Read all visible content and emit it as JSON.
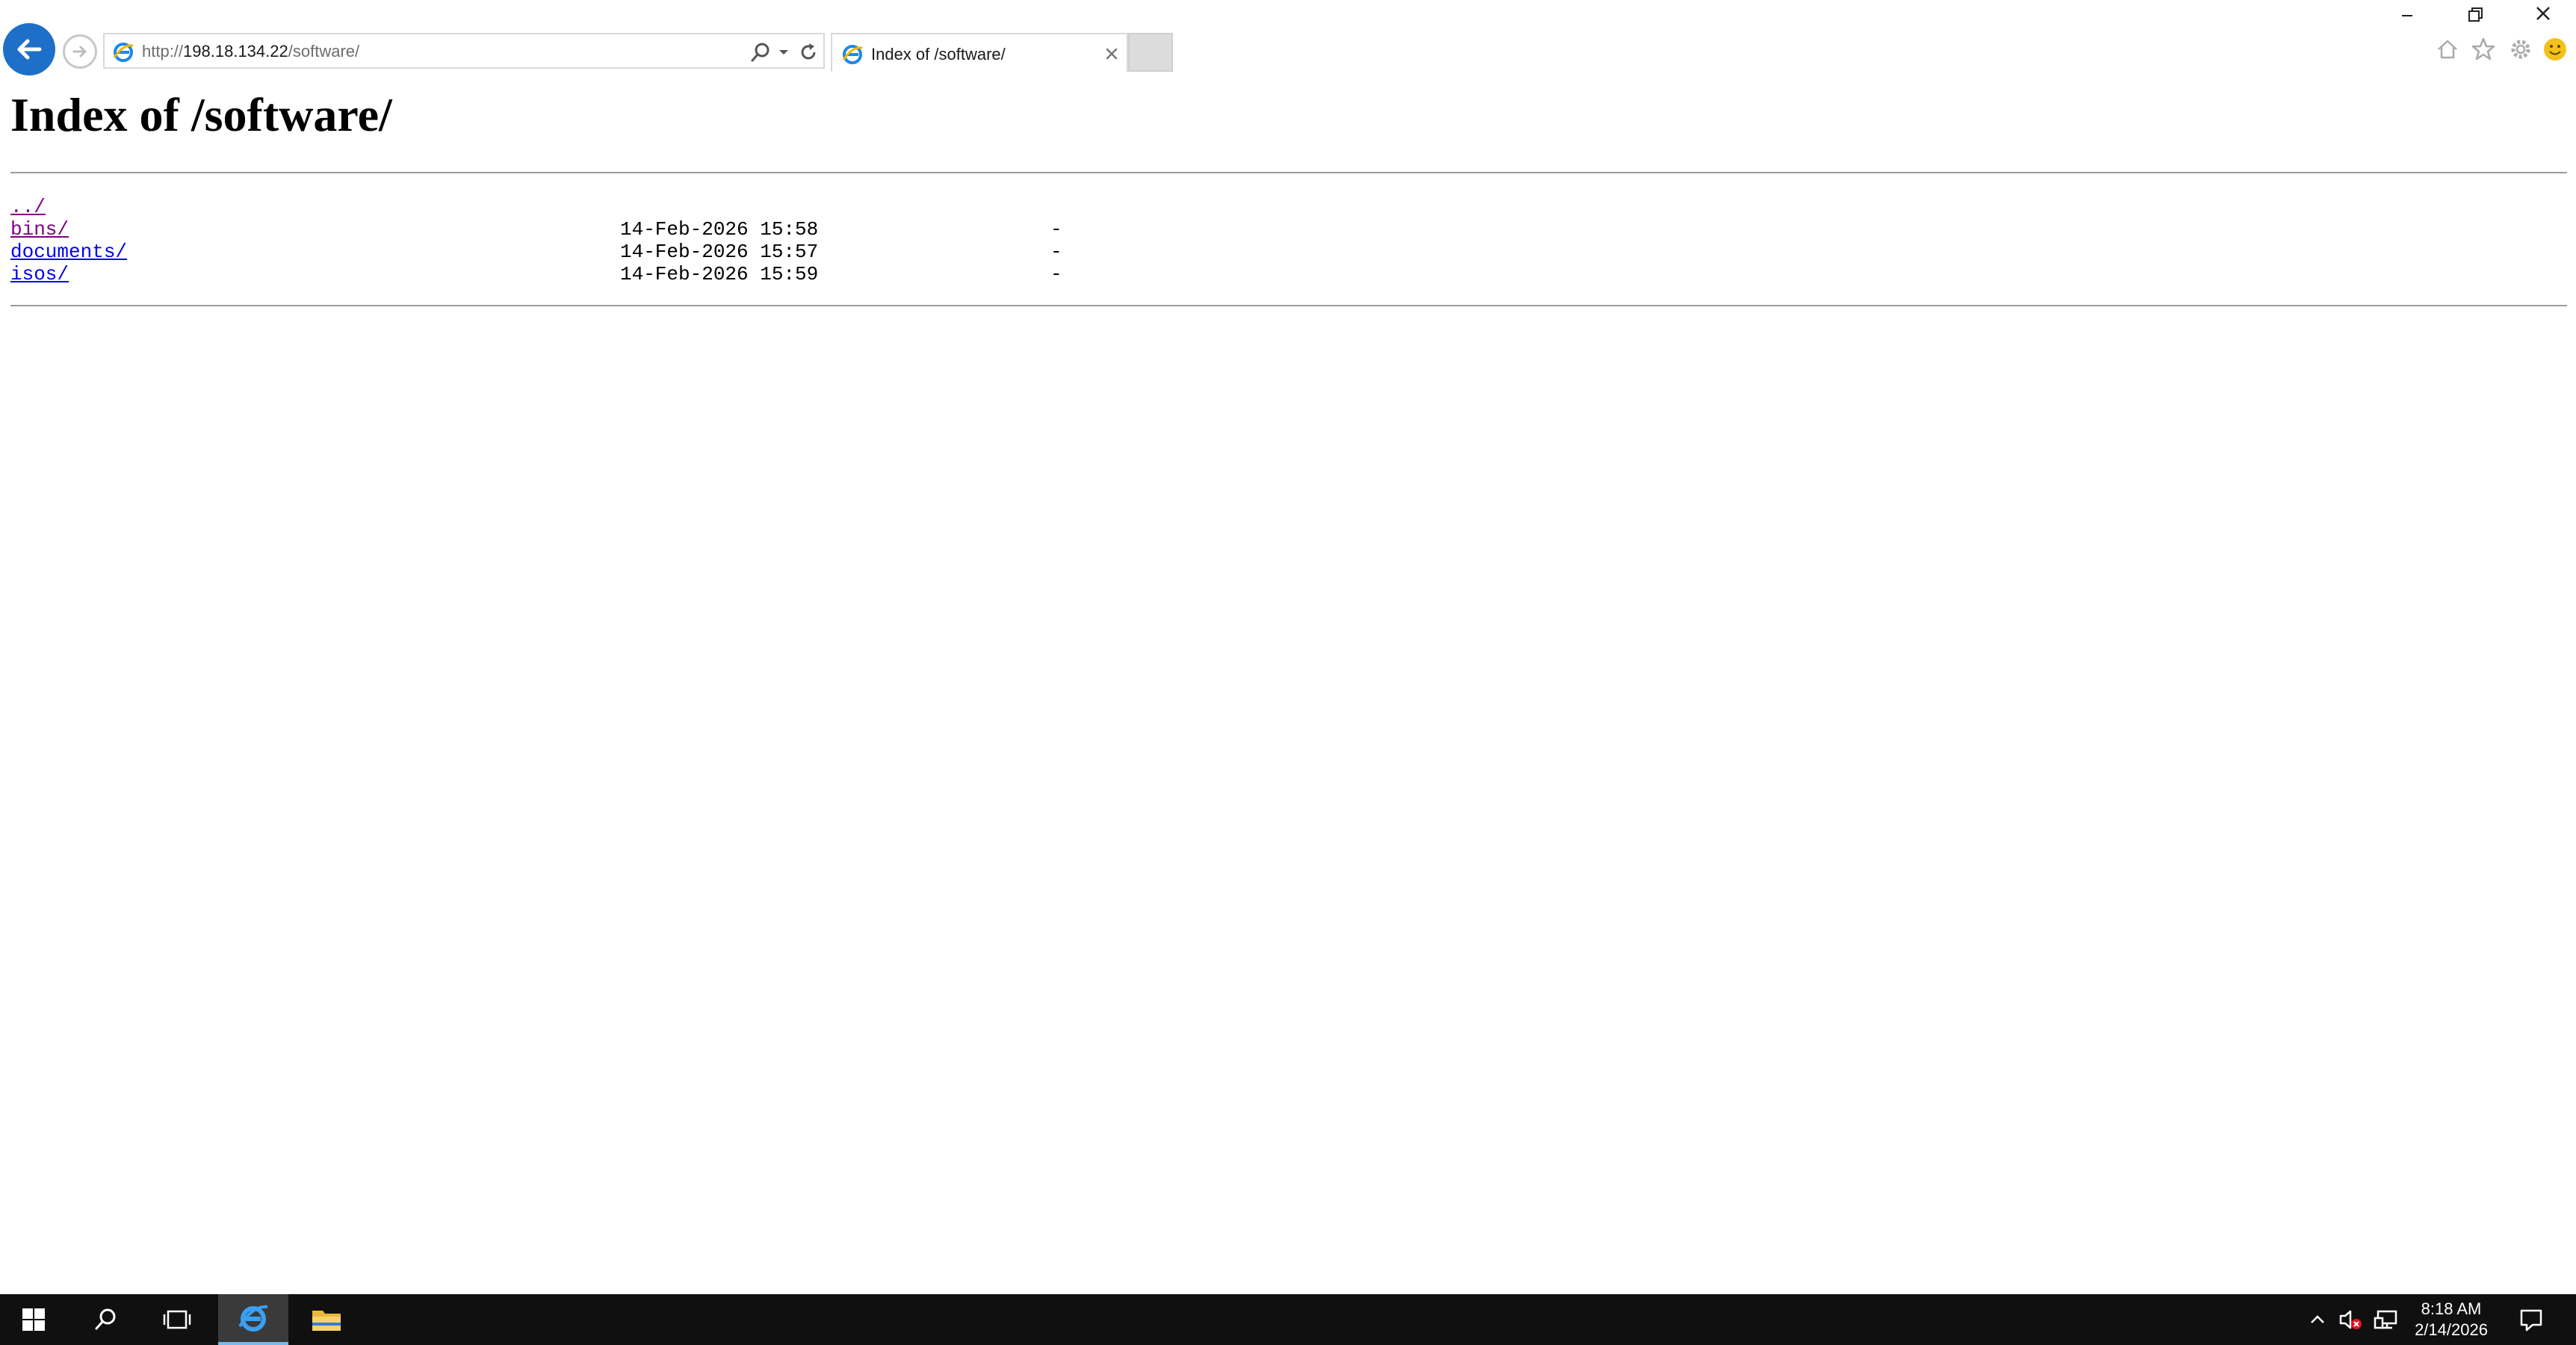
{
  "browser": {
    "address_scheme": "http://",
    "address_host": "198.18.134.22",
    "address_path": "/software/",
    "tab_title": "Index of /software/"
  },
  "page": {
    "title": "Index of /software/",
    "parent_link": "../",
    "entries": [
      {
        "name": "bins/",
        "date": "14-Feb-2026 15:58",
        "size": "-"
      },
      {
        "name": "documents/",
        "date": "14-Feb-2026 15:57",
        "size": "-"
      },
      {
        "name": "isos/",
        "date": "14-Feb-2026 15:59",
        "size": "-"
      }
    ]
  },
  "taskbar": {
    "time": "8:18 AM",
    "date": "2/14/2026"
  },
  "colors": {
    "link_visited": "#800080",
    "link_unvisited": "#0000ee",
    "ie_blue": "#1e6fc8",
    "taskbar_bg": "#101010"
  },
  "icons": [
    "back-arrow-icon",
    "forward-arrow-icon",
    "ie-icon",
    "search-icon",
    "dropdown-icon",
    "refresh-icon",
    "close-icon",
    "minimize-icon",
    "restore-icon",
    "home-icon",
    "star-icon",
    "gear-icon",
    "smiley-icon",
    "windows-start-icon",
    "taskview-icon",
    "folder-icon",
    "chevron-up-icon",
    "speaker-muted-icon",
    "network-icon",
    "notification-icon"
  ]
}
